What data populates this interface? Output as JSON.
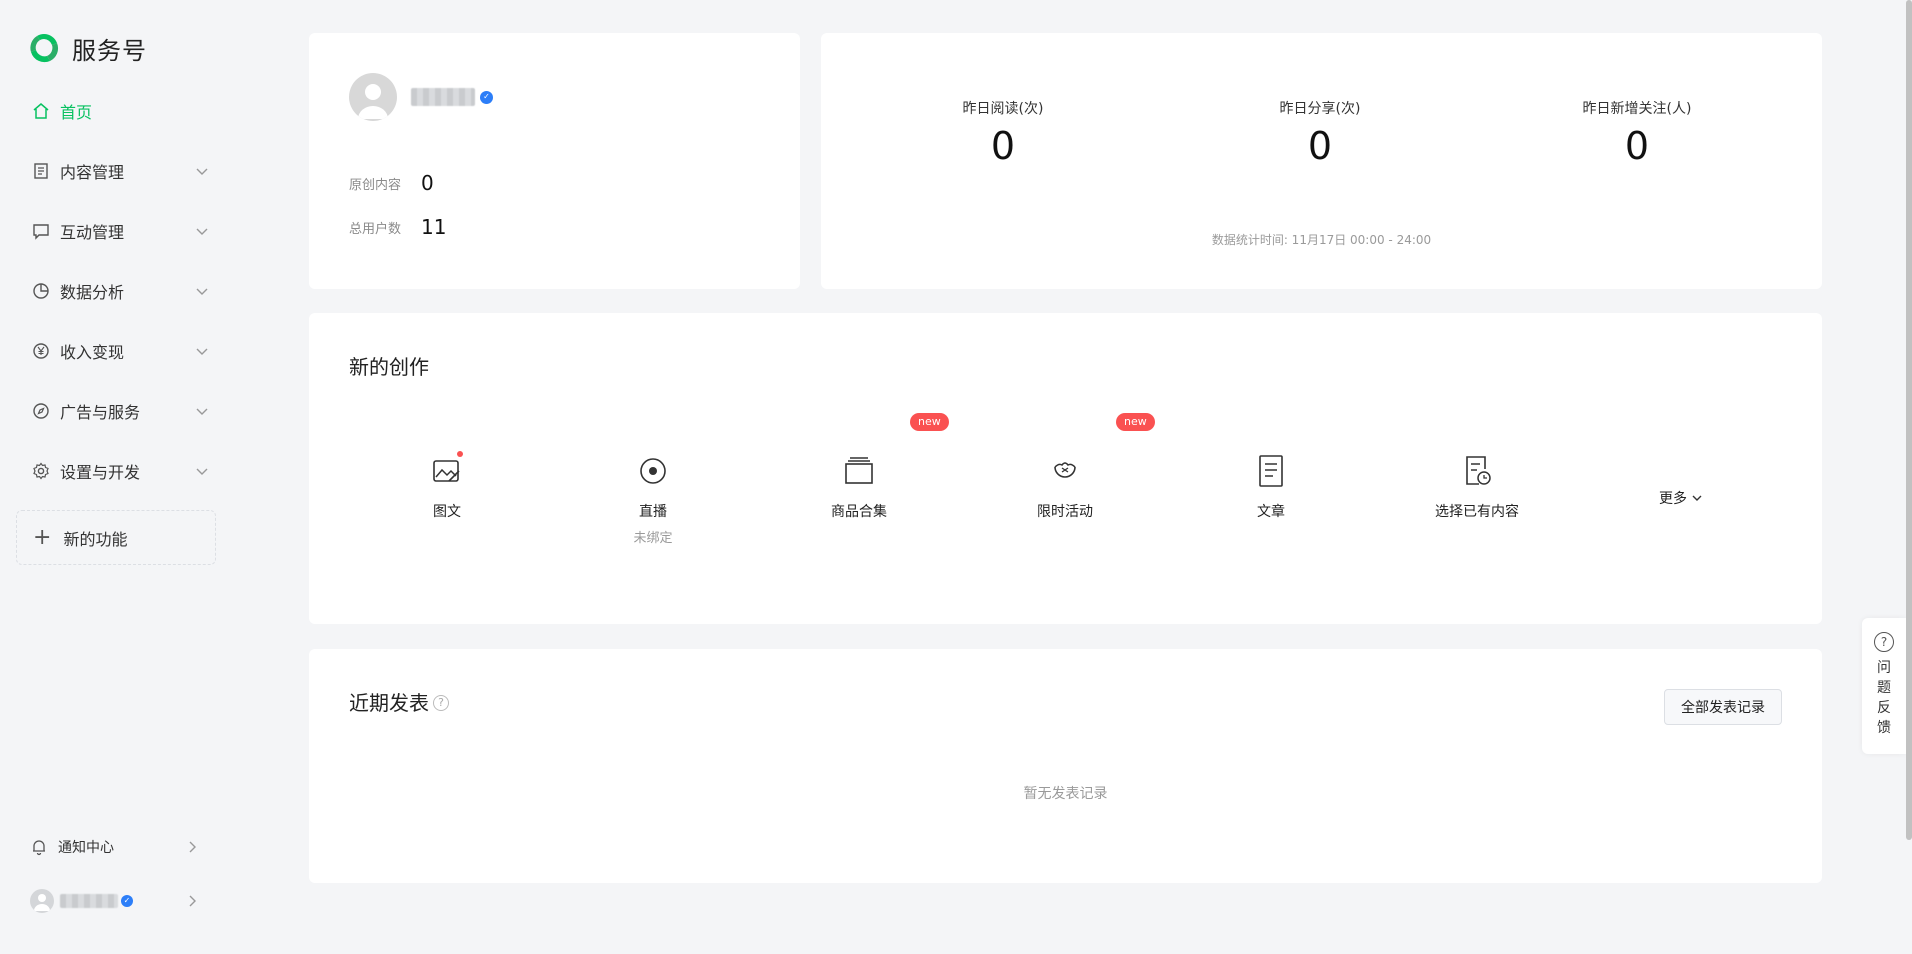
{
  "brand": {
    "name": "服务号",
    "accent": "#07c160"
  },
  "sidebar": {
    "items": [
      {
        "label": "首页",
        "icon": "home-icon",
        "active": true
      },
      {
        "label": "内容管理",
        "icon": "document-icon"
      },
      {
        "label": "互动管理",
        "icon": "chat-icon"
      },
      {
        "label": "数据分析",
        "icon": "pie-chart-icon"
      },
      {
        "label": "收入变现",
        "icon": "yen-icon"
      },
      {
        "label": "广告与服务",
        "icon": "compass-icon"
      },
      {
        "label": "设置与开发",
        "icon": "gear-icon"
      }
    ],
    "new_feature": "新的功能",
    "notification": "通知中心"
  },
  "profile": {
    "stats": [
      {
        "label": "原创内容",
        "value": "0"
      },
      {
        "label": "总用户数",
        "value": "11"
      }
    ]
  },
  "stats": {
    "items": [
      {
        "label": "昨日阅读(次)",
        "value": "0"
      },
      {
        "label": "昨日分享(次)",
        "value": "0"
      },
      {
        "label": "昨日新增关注(人)",
        "value": "0"
      }
    ],
    "footer": "数据统计时间: 11月17日 00:00 - 24:00"
  },
  "create": {
    "title": "新的创作",
    "tools": [
      {
        "label": "图文",
        "icon": "image-text-icon",
        "dot": true
      },
      {
        "label": "直播",
        "sub": "未绑定",
        "icon": "live-icon"
      },
      {
        "label": "商品合集",
        "icon": "product-collection-icon",
        "badge": "new"
      },
      {
        "label": "限时活动",
        "icon": "tomato-icon",
        "badge": "new"
      },
      {
        "label": "文章",
        "icon": "article-icon"
      },
      {
        "label": "选择已有内容",
        "icon": "select-content-icon"
      }
    ],
    "more": "更多"
  },
  "recent": {
    "title": "近期发表",
    "all_button": "全部发表记录",
    "empty": "暂无发表记录"
  },
  "feedback": {
    "label": "问题反馈"
  }
}
